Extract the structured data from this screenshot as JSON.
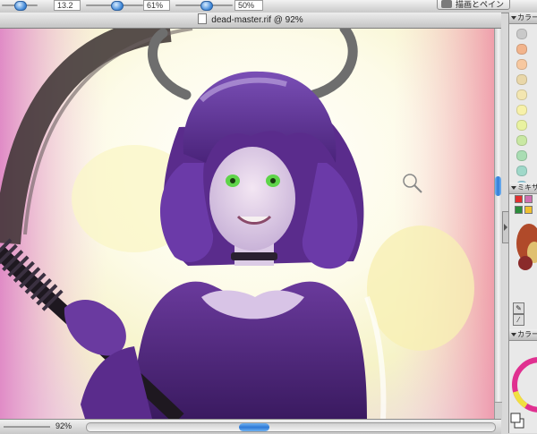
{
  "toolbar": {
    "brush_size_value": "13.2",
    "opacity_value": "61%",
    "density_value": "50%",
    "paint_button_label": "描画とペイント"
  },
  "document": {
    "title": "dead-master.rif @ 92%",
    "zoom": "92%"
  },
  "panels": {
    "color_sets": {
      "title": "カラー",
      "swatches": [
        "#c9c9c9",
        "#f2b48c",
        "#f7c8a0",
        "#e9d7a9",
        "#f3e6b1",
        "#f7f1a9",
        "#e9f2a0",
        "#c9e8a3",
        "#a9ddb3",
        "#9fd8c9",
        "#98d0e0",
        "#a8c0ea",
        "#b9b3ea",
        "#c9a8e6",
        "#e0a3d8",
        "#f0a3c0",
        "#f5b1b8",
        "#f6c9c9",
        "#f2d6dc",
        "#ffffff"
      ]
    },
    "mixer": {
      "title": "ミキサ",
      "colors": [
        "#e03030",
        "#d06fb0",
        "#2c8c3c",
        "#f0c030"
      ]
    },
    "color_wheel": {
      "title": "カラー"
    }
  },
  "canvas": {
    "cursor": "magnifier-cursor-icon"
  },
  "colors": {
    "accent": "#2f7ad6",
    "hair": "#5a2c8c",
    "eyes": "#5fd44a"
  }
}
